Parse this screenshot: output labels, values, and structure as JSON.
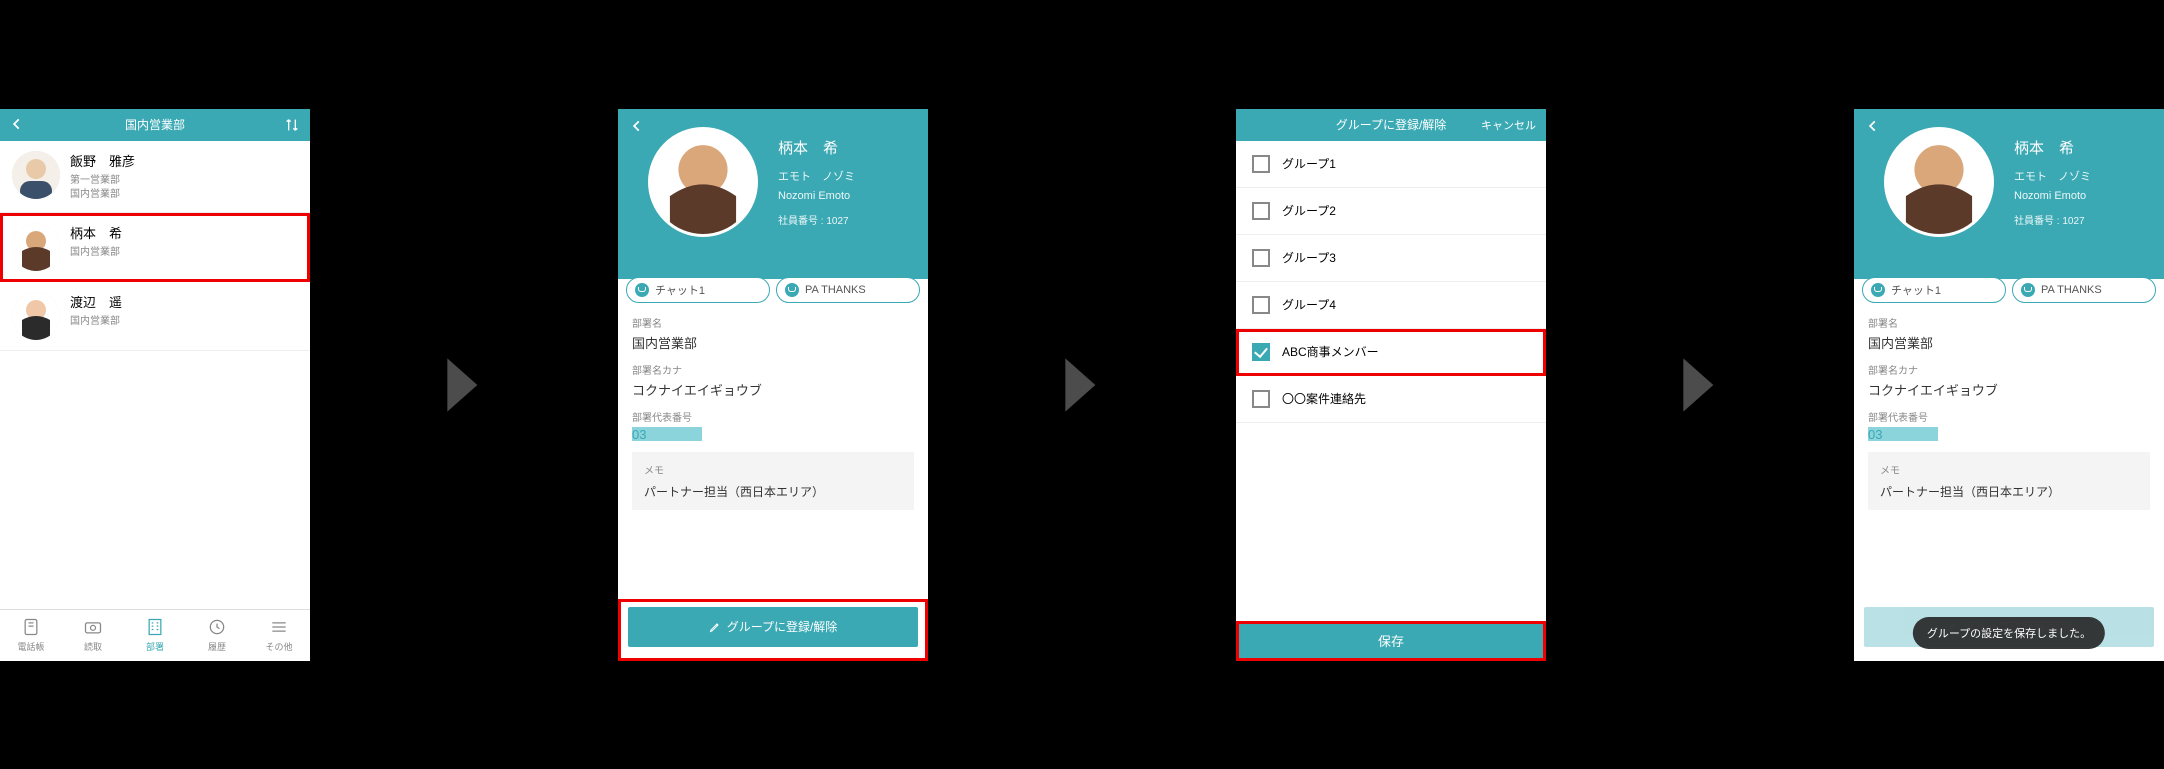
{
  "screen1": {
    "title": "国内営業部",
    "contacts": [
      {
        "name": "飯野　雅彦",
        "line1": "第一営業部",
        "line2": "国内営業部"
      },
      {
        "name": "柄本　希",
        "line1": "国内営業部",
        "line2": ""
      },
      {
        "name": "渡辺　遥",
        "line1": "国内営業部",
        "line2": ""
      }
    ],
    "tabs": [
      "電話帳",
      "読取",
      "部署",
      "履歴",
      "その他"
    ],
    "active_tab_index": 2
  },
  "profile": {
    "name": "柄本　希",
    "kana": "エモト　ノゾミ",
    "roman": "Nozomi Emoto",
    "emp_no_label": "社員番号 : 1027",
    "pills": [
      "チャット1",
      "PA THANKS"
    ],
    "dept_label": "部署名",
    "dept_value": "国内営業部",
    "dept_kana_label": "部署名カナ",
    "dept_kana_value": "コクナイエイギョウブ",
    "tel_label": "部署代表番号",
    "tel_value": "03",
    "memo_label": "メモ",
    "memo_value": "パートナー担当（西日本エリア）",
    "group_button": "グループに登録/解除"
  },
  "groups": {
    "title": "グループに登録/解除",
    "cancel": "キャンセル",
    "items": [
      {
        "label": "グループ1",
        "checked": false
      },
      {
        "label": "グループ2",
        "checked": false
      },
      {
        "label": "グループ3",
        "checked": false
      },
      {
        "label": "グループ4",
        "checked": false
      },
      {
        "label": "ABC商事メンバー",
        "checked": true
      },
      {
        "label": "〇〇案件連絡先",
        "checked": false
      }
    ],
    "save": "保存"
  },
  "toast": "グループの設定を保存しました。"
}
